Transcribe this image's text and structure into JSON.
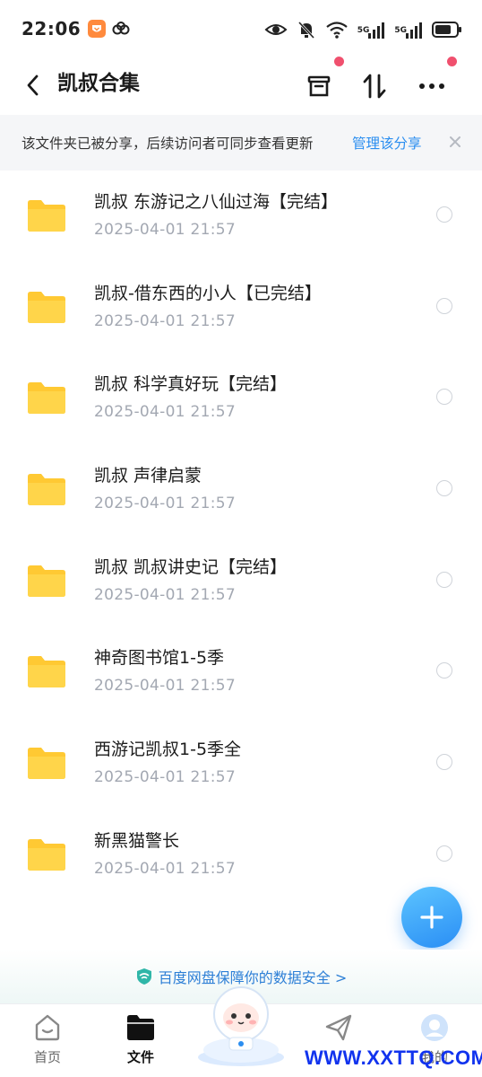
{
  "status_bar": {
    "time": "22:06",
    "signal_label_1": "5G",
    "signal_label_2": "5G"
  },
  "header": {
    "title": "凯叔合集",
    "back_icon": "chevron-left-icon",
    "archive_icon": "archive-box-icon",
    "sort_icon": "sort-arrows-icon",
    "more_icon": "more-dots-icon"
  },
  "share_banner": {
    "text": "该文件夹已被分享，后续访问者可同步查看更新",
    "manage_label": "管理该分享"
  },
  "files": [
    {
      "name": "凯叔 东游记之八仙过海【完结】",
      "date": "2025-04-01  21:57"
    },
    {
      "name": "凯叔-借东西的小人【已完结】",
      "date": "2025-04-01  21:57"
    },
    {
      "name": "凯叔 科学真好玩【完结】",
      "date": "2025-04-01  21:57"
    },
    {
      "name": "凯叔 声律启蒙",
      "date": "2025-04-01  21:57"
    },
    {
      "name": "凯叔  凯叔讲史记【完结】",
      "date": "2025-04-01  21:57"
    },
    {
      "name": "神奇图书馆1-5季",
      "date": "2025-04-01  21:57"
    },
    {
      "name": "西游记凯叔1-5季全",
      "date": "2025-04-01  21:57"
    },
    {
      "name": "新黑猫警长",
      "date": "2025-04-01  21:57"
    }
  ],
  "safety_notice": "百度网盘保障你的数据安全 >",
  "bottom_nav": {
    "home": "首页",
    "files": "文件",
    "me": "我的"
  },
  "watermark": "WWW.XXTTQ.COM",
  "colors": {
    "accent": "#2b8ef0",
    "folder": "#ffcf3e",
    "red_dot": "#f0506e",
    "watermark": "#1133ee"
  }
}
